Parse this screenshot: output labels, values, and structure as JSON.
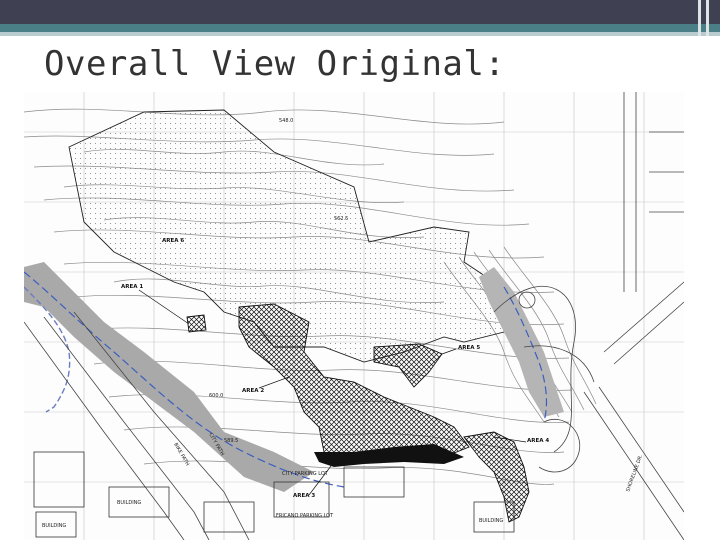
{
  "slide": {
    "title": "Overall View Original:"
  },
  "map": {
    "area_labels": [
      "AREA 1",
      "AREA 2",
      "AREA 3",
      "AREA 4",
      "AREA 5",
      "AREA 6"
    ],
    "contour_labels": [
      "548.0",
      "562.5",
      "600.0",
      "589.5"
    ],
    "site_labels": [
      "CITY PARKING LOT",
      "FRICANO PARKING LOT",
      "BUILDING",
      "BUILDING",
      "BUILDING",
      "BIKE PATH",
      "CITY PATH",
      "SHORELINE DR."
    ]
  }
}
